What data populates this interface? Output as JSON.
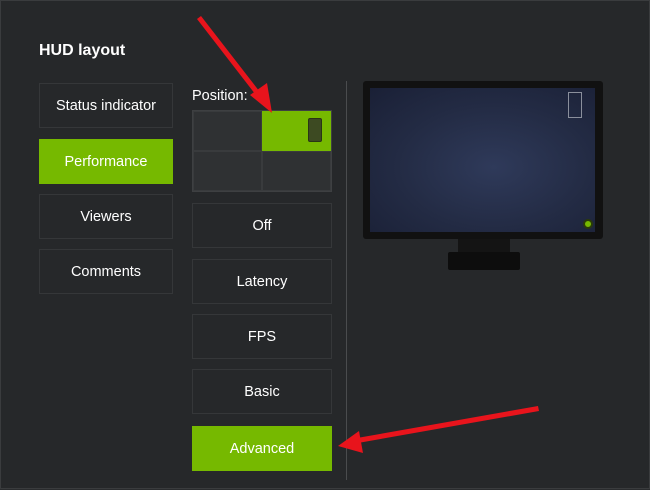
{
  "panel": {
    "title": "HUD layout"
  },
  "tabs": [
    {
      "label": "Status indicator",
      "active": false
    },
    {
      "label": "Performance",
      "active": true
    },
    {
      "label": "Viewers",
      "active": false
    },
    {
      "label": "Comments",
      "active": false
    }
  ],
  "position": {
    "label": "Position:",
    "selected": "top-right"
  },
  "modes": [
    {
      "label": "Off",
      "active": false
    },
    {
      "label": "Latency",
      "active": false
    },
    {
      "label": "FPS",
      "active": false
    },
    {
      "label": "Basic",
      "active": false
    },
    {
      "label": "Advanced",
      "active": true
    }
  ],
  "colors": {
    "accent": "#76b900",
    "background": "#26282a",
    "annotation_arrow": "#e8141c"
  },
  "icons": {
    "monitor": "monitor-preview-icon",
    "power": "power-indicator-icon"
  }
}
